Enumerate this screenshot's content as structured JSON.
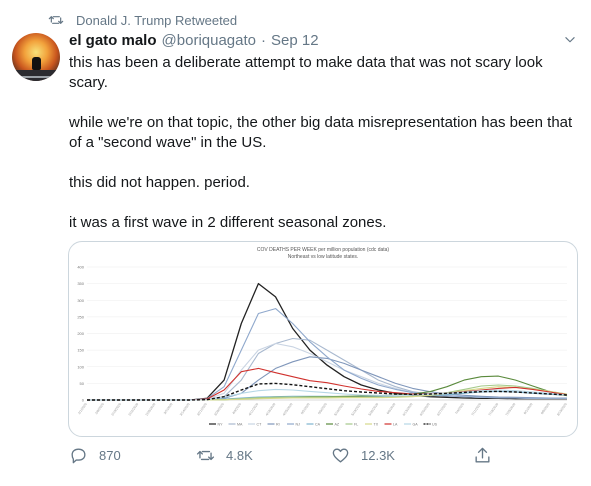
{
  "retweet_banner": {
    "text": "Donald J. Trump Retweeted"
  },
  "tweet": {
    "display_name": "el gato malo",
    "handle": "@boriquagato",
    "separator": "·",
    "date": "Sep 12",
    "paragraphs": [
      "this has been a deliberate attempt to make data that was not scary look scary.",
      "while we're on that topic, the other big data misrepresentation has been that of a \"second wave\" in the US.",
      "this did not happen.  period.",
      "it was a first wave in 2 different seasonal zones."
    ]
  },
  "actions": {
    "replies": "870",
    "retweets": "4.8K",
    "likes": "12.3K"
  },
  "icons": {
    "retweet_banner": "retweet-icon",
    "caret": "chevron-down-icon",
    "reply": "reply-icon",
    "retweet": "retweet-icon",
    "like": "heart-icon",
    "share": "share-icon"
  },
  "colors": {
    "secondary_text": "#657786",
    "primary_text": "#14171a",
    "border": "#ccd6dd"
  },
  "chart_data": {
    "type": "line",
    "title": "COV DEATHS PER WEEK per million population (cdc data)",
    "subtitle": "Northeast vs low latitude states.",
    "xlabel": "",
    "ylabel": "",
    "ylim": [
      0,
      400
    ],
    "yticks": [
      0,
      50,
      100,
      150,
      200,
      250,
      300,
      350,
      400
    ],
    "x": [
      "2/1/2020",
      "2/8/2020",
      "2/15/2020",
      "2/22/2020",
      "2/29/2020",
      "3/7/2020",
      "3/14/2020",
      "3/21/2020",
      "3/28/2020",
      "4/4/2020",
      "4/11/2020",
      "4/18/2020",
      "4/25/2020",
      "5/2/2020",
      "5/9/2020",
      "5/16/2020",
      "5/23/2020",
      "5/30/2020",
      "6/6/2020",
      "6/13/2020",
      "6/20/2020",
      "6/27/2020",
      "7/4/2020",
      "7/11/2020",
      "7/18/2020",
      "7/25/2020",
      "8/1/2020",
      "8/8/2020",
      "8/15/2020"
    ],
    "xtick_labels": [
      "2/1/2020",
      "2/8/2020",
      "2/15/2020",
      "2/22/2020",
      "2/29/2020",
      "3/7/2020",
      "3/14/2020",
      "3/21/2020",
      "3/28/2020",
      "4/4/2020",
      "4/11/2020",
      "4/18/2020",
      "4/25/2020",
      "5/2/2020",
      "5/9/2020",
      "5/16/2020",
      "5/23/2020",
      "5/30/2020",
      "6/6/2020",
      "6/13/2020",
      "6/20/2020",
      "6/27/2020",
      "7/4/2020",
      "7/11/2020",
      "7/18/2020",
      "7/25/2020",
      "8/1/2020",
      "8/8/2020",
      "8/15/2020"
    ],
    "legend_position": "bottom",
    "grid": true,
    "series": [
      {
        "name": "NY",
        "color": "#222222",
        "dash": false,
        "values": [
          0,
          0,
          0,
          0,
          0,
          0,
          0,
          5,
          60,
          230,
          350,
          310,
          215,
          150,
          105,
          70,
          45,
          30,
          20,
          14,
          10,
          8,
          6,
          5,
          5,
          4,
          4,
          4,
          4
        ]
      },
      {
        "name": "MA",
        "color": "#a9b9cf",
        "dash": false,
        "values": [
          0,
          0,
          0,
          0,
          0,
          0,
          0,
          2,
          10,
          60,
          140,
          170,
          185,
          180,
          150,
          120,
          90,
          60,
          40,
          25,
          18,
          14,
          10,
          8,
          7,
          6,
          5,
          5,
          5
        ]
      },
      {
        "name": "CT",
        "color": "#c9d4e3",
        "dash": false,
        "values": [
          0,
          0,
          0,
          0,
          0,
          0,
          0,
          3,
          20,
          90,
          150,
          170,
          160,
          140,
          115,
          90,
          70,
          50,
          35,
          22,
          15,
          12,
          10,
          8,
          7,
          6,
          5,
          5,
          5
        ]
      },
      {
        "name": "RI",
        "color": "#7f96ba",
        "dash": false,
        "values": [
          0,
          0,
          0,
          0,
          0,
          0,
          0,
          0,
          5,
          20,
          60,
          95,
          115,
          130,
          125,
          110,
          90,
          70,
          50,
          35,
          25,
          18,
          14,
          11,
          9,
          8,
          7,
          6,
          6
        ]
      },
      {
        "name": "NJ",
        "color": "#8fa8cc",
        "dash": false,
        "values": [
          0,
          0,
          0,
          0,
          0,
          0,
          0,
          4,
          40,
          150,
          260,
          275,
          230,
          175,
          130,
          90,
          65,
          45,
          32,
          22,
          16,
          12,
          10,
          8,
          7,
          6,
          5,
          5,
          5
        ]
      },
      {
        "name": "CA",
        "color": "#7fb4cf",
        "dash": false,
        "values": [
          0,
          0,
          0,
          0,
          0,
          0,
          0,
          1,
          3,
          6,
          9,
          10,
          11,
          11,
          11,
          10,
          10,
          10,
          10,
          11,
          13,
          16,
          20,
          24,
          26,
          24,
          20,
          17,
          14
        ]
      },
      {
        "name": "AZ",
        "color": "#5a8a3c",
        "dash": false,
        "values": [
          0,
          0,
          0,
          0,
          0,
          0,
          0,
          0,
          1,
          3,
          6,
          8,
          9,
          10,
          10,
          11,
          12,
          13,
          15,
          18,
          25,
          40,
          60,
          70,
          72,
          60,
          42,
          25,
          13
        ]
      },
      {
        "name": "FL",
        "color": "#a5c98a",
        "dash": false,
        "values": [
          0,
          0,
          0,
          0,
          0,
          0,
          0,
          0,
          1,
          4,
          7,
          8,
          9,
          9,
          9,
          9,
          8,
          8,
          9,
          11,
          14,
          22,
          32,
          42,
          45,
          42,
          35,
          26,
          18
        ]
      },
      {
        "name": "TX",
        "color": "#d6d98a",
        "dash": false,
        "values": [
          0,
          0,
          0,
          0,
          0,
          0,
          0,
          0,
          1,
          2,
          4,
          5,
          6,
          6,
          6,
          7,
          7,
          7,
          8,
          10,
          14,
          20,
          28,
          35,
          40,
          38,
          33,
          26,
          17
        ]
      },
      {
        "name": "LA",
        "color": "#d0312d",
        "dash": false,
        "values": [
          0,
          0,
          0,
          0,
          0,
          0,
          0,
          3,
          30,
          85,
          95,
          82,
          70,
          58,
          52,
          42,
          33,
          26,
          22,
          18,
          18,
          20,
          25,
          30,
          35,
          38,
          32,
          24,
          16
        ]
      },
      {
        "name": "GA",
        "color": "#b6d7e6",
        "dash": false,
        "values": [
          0,
          0,
          0,
          0,
          0,
          0,
          0,
          1,
          8,
          20,
          28,
          32,
          30,
          26,
          22,
          18,
          15,
          14,
          14,
          15,
          17,
          20,
          24,
          28,
          30,
          28,
          24,
          20,
          15
        ]
      },
      {
        "name": "US",
        "color": "#111111",
        "dash": true,
        "values": [
          0,
          0,
          0,
          0,
          0,
          0,
          0,
          1,
          10,
          30,
          48,
          50,
          46,
          40,
          34,
          28,
          24,
          21,
          18,
          17,
          18,
          20,
          23,
          25,
          26,
          24,
          21,
          18,
          15
        ]
      }
    ]
  }
}
